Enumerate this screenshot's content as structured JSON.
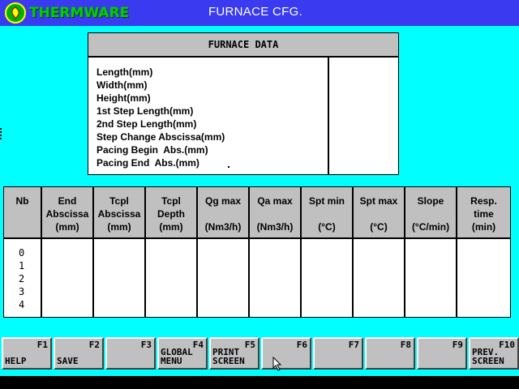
{
  "header": {
    "logo_text": "THERMWARE",
    "title": "FURNACE CFG."
  },
  "furnace_panel": {
    "title": "FURNACE DATA",
    "labels": [
      "Length(mm)",
      "Width(mm)",
      "Height(mm)",
      "1st Step Length(mm)",
      "2nd Step Length(mm)",
      "Step Change Abscissa(mm)",
      "Pacing Begin  Abs.(mm)",
      "Pacing End  Abs.(mm)"
    ]
  },
  "steps_table": {
    "columns": [
      {
        "lines": [
          "Nb"
        ]
      },
      {
        "lines": [
          "End",
          "Abscissa",
          "(mm)"
        ]
      },
      {
        "lines": [
          "Tcpl",
          "Abscissa",
          "(mm)"
        ]
      },
      {
        "lines": [
          "Tcpl",
          "Depth",
          "(mm)"
        ]
      },
      {
        "lines": [
          "Qg max",
          "",
          "(Nm3/h)"
        ]
      },
      {
        "lines": [
          "Qa max",
          "",
          "(Nm3/h)"
        ]
      },
      {
        "lines": [
          "Spt min",
          "",
          "(°C)"
        ]
      },
      {
        "lines": [
          "Spt max",
          "",
          "(°C)"
        ]
      },
      {
        "lines": [
          "Slope",
          "",
          "(°C/min)"
        ]
      },
      {
        "lines": [
          "Resp.",
          "time",
          "(min)"
        ]
      }
    ],
    "row_numbers": [
      "0",
      "1",
      "2",
      "3",
      "4"
    ]
  },
  "function_keys": [
    {
      "key": "F1",
      "label": "HELP"
    },
    {
      "key": "F2",
      "label": "SAVE"
    },
    {
      "key": "F3",
      "label": ""
    },
    {
      "key": "F4",
      "label": "GLOBAL\nMENU"
    },
    {
      "key": "F5",
      "label": "PRINT\nSCREEN"
    },
    {
      "key": "F6",
      "label": ""
    },
    {
      "key": "F7",
      "label": ""
    },
    {
      "key": "F8",
      "label": ""
    },
    {
      "key": "F9",
      "label": ""
    },
    {
      "key": "F10",
      "label": "PREV.\nSCREEN"
    }
  ],
  "colors": {
    "background": "#00ffff",
    "title_bar": "#3a3af0",
    "panel_header": "#c0c0c0",
    "logo_green": "#00d000"
  }
}
